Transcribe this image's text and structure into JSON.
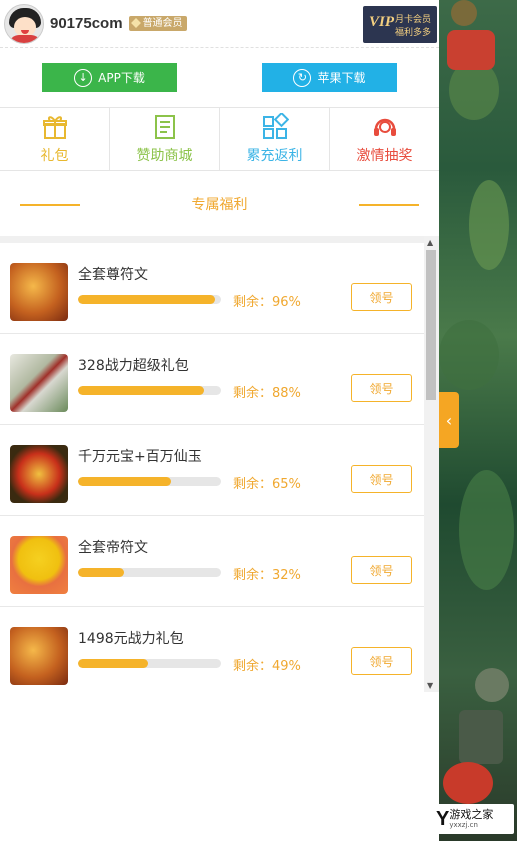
{
  "header": {
    "site_name": "90175com",
    "member_badge": "普通会员",
    "vip": {
      "logo": "VIP",
      "line1": "月卡会员",
      "line2": "福利多多"
    }
  },
  "downloads": {
    "app_label": "APP下载",
    "apple_label": "苹果下载"
  },
  "tabs": [
    {
      "label": "礼包",
      "color": "#e8b830",
      "icon": "gift-icon"
    },
    {
      "label": "赞助商城",
      "color": "#8cc34a",
      "icon": "document-icon"
    },
    {
      "label": "累充返利",
      "color": "#3cb4e6",
      "icon": "grid-icon"
    },
    {
      "label": "激情抽奖",
      "color": "#e84c3d",
      "icon": "headset-icon"
    }
  ],
  "section_title": "专属福利",
  "items": [
    {
      "name": "全套尊符文",
      "remaining_label": "剩余：96%",
      "progress": 0.96,
      "claim_label": "领号",
      "icon": "dragon-icon"
    },
    {
      "name": "328战力超级礼包",
      "remaining_label": "剩余：88%",
      "progress": 0.88,
      "claim_label": "领号",
      "icon": "scroll-icon"
    },
    {
      "name": "千万元宝+百万仙玉",
      "remaining_label": "剩余：65%",
      "progress": 0.65,
      "claim_label": "领号",
      "icon": "phoenix-icon"
    },
    {
      "name": "全套帝符文",
      "remaining_label": "剩余：32%",
      "progress": 0.32,
      "claim_label": "领号",
      "icon": "fan-icon"
    },
    {
      "name": "1498元战力礼包",
      "remaining_label": "剩余：49%",
      "progress": 0.49,
      "claim_label": "领号",
      "icon": "dragon-icon"
    }
  ],
  "side_tab": "‹",
  "brand": {
    "mark": "Y",
    "name": "游戏之家",
    "sub": "yxxzj.cn"
  }
}
